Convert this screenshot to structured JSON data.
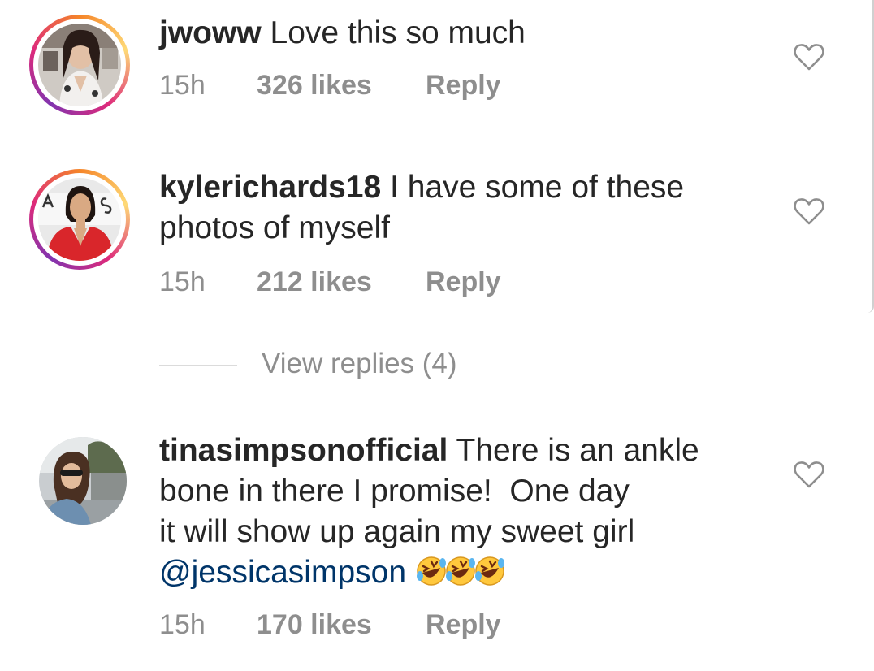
{
  "comments": [
    {
      "username": "jwoww",
      "text": "Love this so much",
      "time": "15h",
      "likes": "326 likes",
      "reply": "Reply"
    },
    {
      "username": "kylerichards18",
      "text": "I have some of these photos of myself",
      "time": "15h",
      "likes": "212 likes",
      "reply": "Reply",
      "view_replies": "View replies (4)"
    },
    {
      "username": "tinasimpsonofficial",
      "text_line1": "There is an ankle",
      "text_line2": "bone in there I promise!  One day",
      "text_line3": "it will show up again my sweet girl",
      "mention": "@jessicasimpson",
      "emoji": "🤣🤣🤣",
      "time": "15h",
      "likes": "170 likes",
      "reply": "Reply"
    }
  ],
  "icons": {
    "like": "heart-outline-icon",
    "emoji": "rolling-on-floor-laughing"
  },
  "colors": {
    "text": "#262626",
    "meta": "#8e8e8e",
    "mention": "#003569",
    "story_ring": [
      "#f58529",
      "#feda77",
      "#dd2a7b",
      "#8134af"
    ]
  }
}
